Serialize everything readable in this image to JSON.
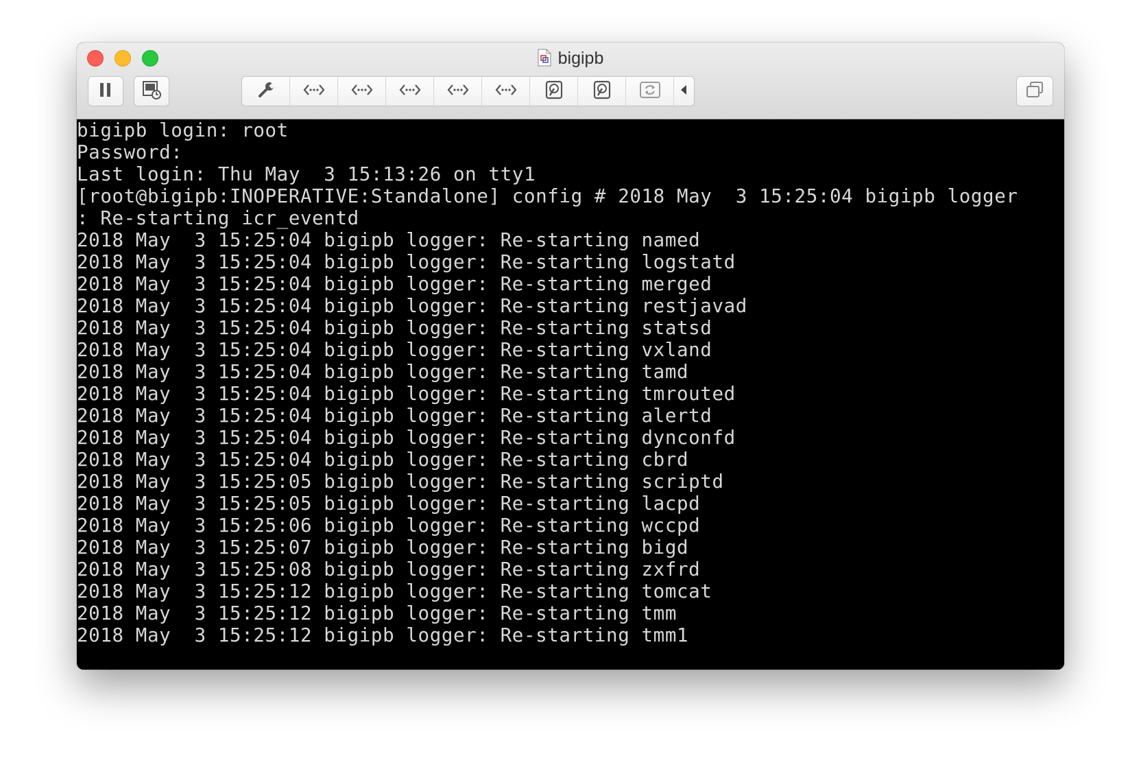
{
  "window": {
    "title": "bigipb"
  },
  "toolbar": {
    "buttons": [
      {
        "name": "pause",
        "icon": "pause-icon"
      },
      {
        "name": "snapshot",
        "icon": "snapshot-icon"
      },
      {
        "name": "settings",
        "icon": "wrench-icon"
      },
      {
        "name": "network-adapter-1",
        "icon": "network-adapter-icon"
      },
      {
        "name": "network-adapter-2",
        "icon": "network-adapter-icon"
      },
      {
        "name": "network-adapter-3",
        "icon": "network-adapter-icon"
      },
      {
        "name": "network-adapter-4",
        "icon": "network-adapter-icon"
      },
      {
        "name": "network-adapter-5",
        "icon": "network-adapter-icon"
      },
      {
        "name": "hard-disk-1",
        "icon": "hard-disk-icon"
      },
      {
        "name": "hard-disk-2",
        "icon": "hard-disk-icon"
      },
      {
        "name": "sync",
        "icon": "sync-icon"
      },
      {
        "name": "collapse",
        "icon": "chevron-left-icon"
      },
      {
        "name": "fullscreen",
        "icon": "unity-icon"
      }
    ]
  },
  "terminal": {
    "lines": [
      "bigipb login: root",
      "Password:",
      "Last login: Thu May  3 15:13:26 on tty1",
      "[root@bigipb:INOPERATIVE:Standalone] config # 2018 May  3 15:25:04 bigipb logger",
      ": Re-starting icr_eventd",
      "2018 May  3 15:25:04 bigipb logger: Re-starting named",
      "2018 May  3 15:25:04 bigipb logger: Re-starting logstatd",
      "2018 May  3 15:25:04 bigipb logger: Re-starting merged",
      "2018 May  3 15:25:04 bigipb logger: Re-starting restjavad",
      "2018 May  3 15:25:04 bigipb logger: Re-starting statsd",
      "2018 May  3 15:25:04 bigipb logger: Re-starting vxland",
      "2018 May  3 15:25:04 bigipb logger: Re-starting tamd",
      "2018 May  3 15:25:04 bigipb logger: Re-starting tmrouted",
      "2018 May  3 15:25:04 bigipb logger: Re-starting alertd",
      "2018 May  3 15:25:04 bigipb logger: Re-starting dynconfd",
      "2018 May  3 15:25:04 bigipb logger: Re-starting cbrd",
      "2018 May  3 15:25:05 bigipb logger: Re-starting scriptd",
      "2018 May  3 15:25:05 bigipb logger: Re-starting lacpd",
      "2018 May  3 15:25:06 bigipb logger: Re-starting wccpd",
      "2018 May  3 15:25:07 bigipb logger: Re-starting bigd",
      "2018 May  3 15:25:08 bigipb logger: Re-starting zxfrd",
      "2018 May  3 15:25:12 bigipb logger: Re-starting tomcat",
      "2018 May  3 15:25:12 bigipb logger: Re-starting tmm",
      "2018 May  3 15:25:12 bigipb logger: Re-starting tmm1"
    ]
  },
  "colors": {
    "terminal_bg": "#000000",
    "terminal_fg": "#d7d7d7",
    "close": "#fc5f57",
    "minimize": "#fdbc2e",
    "zoom": "#28c840"
  }
}
